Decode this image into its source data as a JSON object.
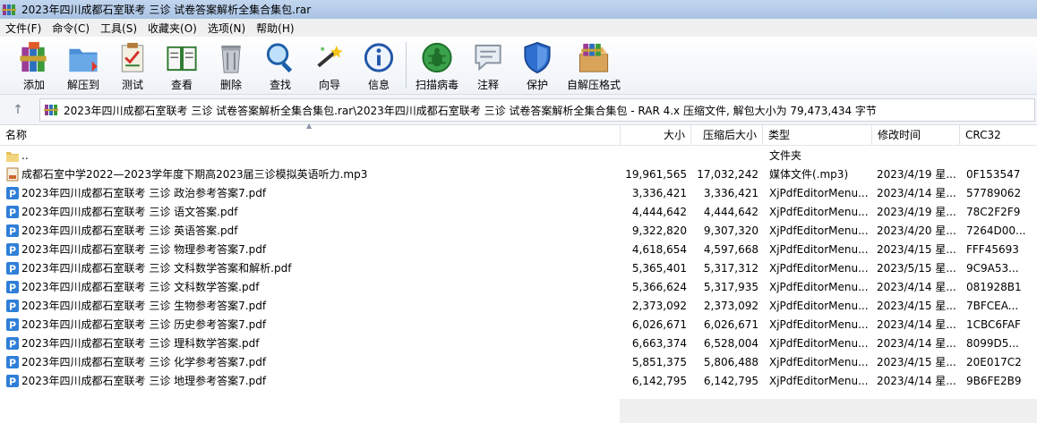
{
  "window": {
    "title": "2023年四川成都石室联考 三诊 试卷答案解析全集合集包.rar"
  },
  "menu": [
    {
      "label": "文件(F)",
      "name": "menu-file"
    },
    {
      "label": "命令(C)",
      "name": "menu-command"
    },
    {
      "label": "工具(S)",
      "name": "menu-tools"
    },
    {
      "label": "收藏夹(O)",
      "name": "menu-favorites"
    },
    {
      "label": "选项(N)",
      "name": "menu-options"
    },
    {
      "label": "帮助(H)",
      "name": "menu-help"
    }
  ],
  "toolbar": {
    "add": "添加",
    "extract": "解压到",
    "test": "测试",
    "view": "查看",
    "delete": "删除",
    "find": "查找",
    "wizard": "向导",
    "info": "信息",
    "virus_scan": "扫描病毒",
    "comment": "注释",
    "protect": "保护",
    "sfx": "自解压格式"
  },
  "address": {
    "up_icon": "arrow-up-icon",
    "path": "2023年四川成都石室联考 三诊 试卷答案解析全集合集包.rar\\2023年四川成都石室联考 三诊 试卷答案解析全集合集包 - RAR 4.x 压缩文件, 解包大小为 79,473,434 字节"
  },
  "columns": {
    "name": "名称",
    "size": "大小",
    "packed": "压缩后大小",
    "type": "类型",
    "modified": "修改时间",
    "crc": "CRC32"
  },
  "rows": [
    {
      "icon": "folder-up-icon",
      "name": "..",
      "size": "",
      "packed": "",
      "type": "文件夹",
      "modified": "",
      "crc": ""
    },
    {
      "icon": "audio-file-icon",
      "name": "成都石室中学2022—2023学年度下期高2023届三诊模拟英语听力.mp3",
      "size": "19,961,565",
      "packed": "17,032,242",
      "type": "媒体文件(.mp3)",
      "modified": "2023/4/19 星...",
      "crc": "0F153547"
    },
    {
      "icon": "pdf-file-icon",
      "name": "2023年四川成都石室联考 三诊 政治参考答案7.pdf",
      "size": "3,336,421",
      "packed": "3,336,421",
      "type": "XjPdfEditorMenu...",
      "modified": "2023/4/14 星...",
      "crc": "57789062"
    },
    {
      "icon": "pdf-file-icon",
      "name": "2023年四川成都石室联考 三诊 语文答案.pdf",
      "size": "4,444,642",
      "packed": "4,444,642",
      "type": "XjPdfEditorMenu...",
      "modified": "2023/4/19 星...",
      "crc": "78C2F2F9"
    },
    {
      "icon": "pdf-file-icon",
      "name": "2023年四川成都石室联考 三诊 英语答案.pdf",
      "size": "9,322,820",
      "packed": "9,307,320",
      "type": "XjPdfEditorMenu...",
      "modified": "2023/4/20 星...",
      "crc": "7264D00..."
    },
    {
      "icon": "pdf-file-icon",
      "name": "2023年四川成都石室联考 三诊 物理参考答案7.pdf",
      "size": "4,618,654",
      "packed": "4,597,668",
      "type": "XjPdfEditorMenu...",
      "modified": "2023/4/15 星...",
      "crc": "FFF45693"
    },
    {
      "icon": "pdf-file-icon",
      "name": "2023年四川成都石室联考 三诊 文科数学答案和解析.pdf",
      "size": "5,365,401",
      "packed": "5,317,312",
      "type": "XjPdfEditorMenu...",
      "modified": "2023/5/15 星...",
      "crc": "9C9A53..."
    },
    {
      "icon": "pdf-file-icon",
      "name": "2023年四川成都石室联考 三诊 文科数学答案.pdf",
      "size": "5,366,624",
      "packed": "5,317,935",
      "type": "XjPdfEditorMenu...",
      "modified": "2023/4/14 星...",
      "crc": "081928B1"
    },
    {
      "icon": "pdf-file-icon",
      "name": "2023年四川成都石室联考 三诊 生物参考答案7.pdf",
      "size": "2,373,092",
      "packed": "2,373,092",
      "type": "XjPdfEditorMenu...",
      "modified": "2023/4/15 星...",
      "crc": "7BFCEA..."
    },
    {
      "icon": "pdf-file-icon",
      "name": "2023年四川成都石室联考 三诊 历史参考答案7.pdf",
      "size": "6,026,671",
      "packed": "6,026,671",
      "type": "XjPdfEditorMenu...",
      "modified": "2023/4/14 星...",
      "crc": "1CBC6FAF"
    },
    {
      "icon": "pdf-file-icon",
      "name": "2023年四川成都石室联考 三诊 理科数学答案.pdf",
      "size": "6,663,374",
      "packed": "6,528,004",
      "type": "XjPdfEditorMenu...",
      "modified": "2023/4/14 星...",
      "crc": "8099D5..."
    },
    {
      "icon": "pdf-file-icon",
      "name": "2023年四川成都石室联考 三诊 化学参考答案7.pdf",
      "size": "5,851,375",
      "packed": "5,806,488",
      "type": "XjPdfEditorMenu...",
      "modified": "2023/4/15 星...",
      "crc": "20E017C2"
    },
    {
      "icon": "pdf-file-icon",
      "name": "2023年四川成都石室联考 三诊 地理参考答案7.pdf",
      "size": "6,142,795",
      "packed": "6,142,795",
      "type": "XjPdfEditorMenu...",
      "modified": "2023/4/14 星...",
      "crc": "9B6FE2B9"
    }
  ],
  "colors": {
    "pdf_icon": "#2f7fd8",
    "folder_icon": "#e6c25a",
    "right_pane_bg": "#f0f0f0"
  }
}
